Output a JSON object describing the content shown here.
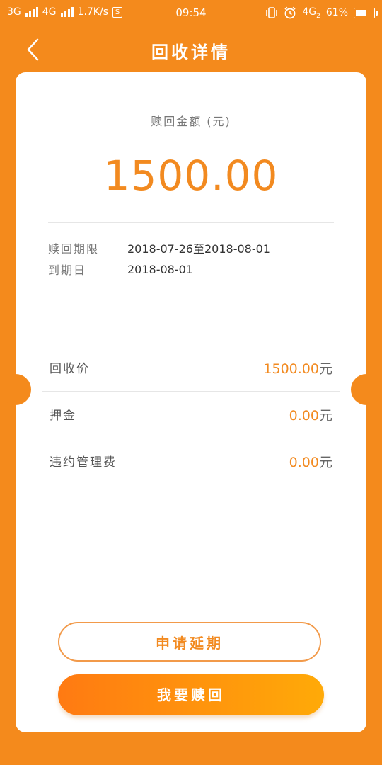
{
  "status_bar": {
    "network1": "3G",
    "network2": "4G",
    "speed": "1.7K/s",
    "s_badge": "S",
    "time": "09:54",
    "network3": "4G",
    "network3_sub": "2",
    "battery": "61%",
    "battery_level": 0.61
  },
  "header": {
    "title": "回收详情",
    "back_icon": "chevron-left-icon"
  },
  "summary": {
    "amount_label": "赎回金额 (元)",
    "amount": "1500.00",
    "period_label": "赎回期限",
    "period_value": "2018-07-26至2018-08-01",
    "due_label": "到期日",
    "due_value": "2018-08-01"
  },
  "fees": [
    {
      "label": "回收价",
      "value": "1500.00",
      "unit": "元"
    },
    {
      "label": "押金",
      "value": "0.00",
      "unit": "元"
    },
    {
      "label": "违约管理费",
      "value": "0.00",
      "unit": "元"
    }
  ],
  "actions": {
    "extend_label": "申请延期",
    "redeem_label": "我要赎回"
  },
  "colors": {
    "background": "#F48A1C",
    "accent": "#F28A20",
    "gradient_start": "#FF7A12",
    "gradient_end": "#FFAA08"
  }
}
